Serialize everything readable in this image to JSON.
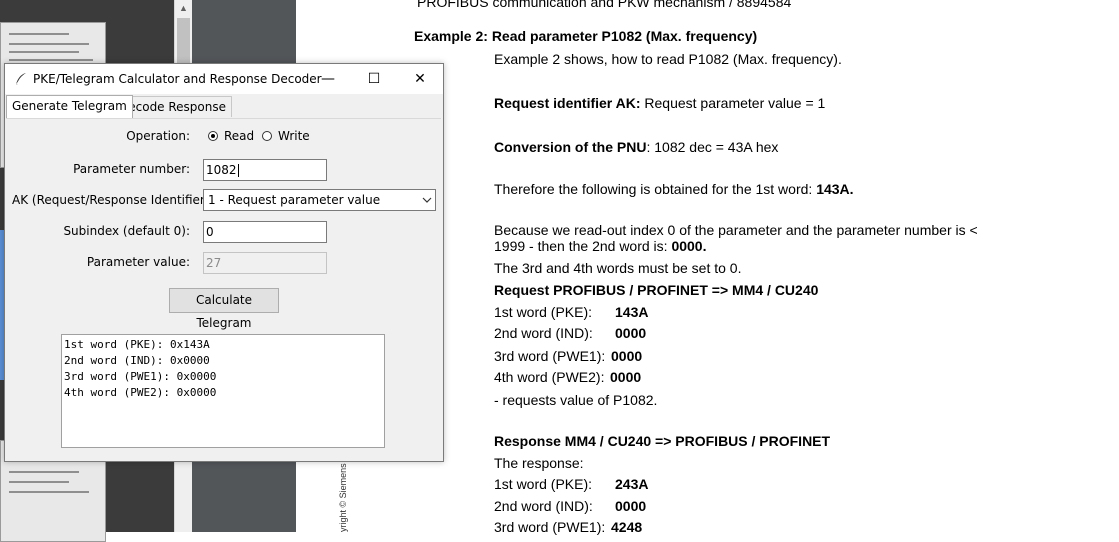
{
  "document": {
    "header_line": "PROFIBUS communication and PKW mechanism / 8894584",
    "example_title": "Example 2: Read parameter P1082 (Max. frequency)",
    "intro": "Example 2 shows, how to read P1082 (Max. frequency).",
    "req_id_label": "Request identifier AK:",
    "req_id_text": " Request parameter value = 1",
    "pnu_label": "Conversion of the PNU",
    "pnu_text": ": 1082 dec = 43A hex",
    "first_word_text": "Therefore the following is obtained for the 1st word: ",
    "first_word_value": "143A.",
    "index_line1": "Because we read-out index 0 of the parameter and the parameter number is <",
    "index_line2": "1999 - then the 2nd word is: ",
    "index_value": "0000.",
    "words_zero": "The 3rd and 4th words must be set to 0.",
    "request_heading": "Request PROFIBUS / PROFINET => MM4 / CU240",
    "request_words": [
      {
        "label": "1st word (PKE):",
        "value": "143A"
      },
      {
        "label": "2nd word (IND):",
        "value": "0000"
      },
      {
        "label": "3rd word (PWE1):",
        "value": "0000"
      },
      {
        "label": "4th word (PWE2):",
        "value": "0000"
      }
    ],
    "request_note": "- requests value of P1082.",
    "response_heading": "Response MM4 / CU240 => PROFIBUS / PROFINET",
    "response_intro": "The response:",
    "response_words": [
      {
        "label": "1st word (PKE):",
        "value": "243A"
      },
      {
        "label": "2nd word (IND):",
        "value": "0000"
      },
      {
        "label": "3rd word (PWE1):",
        "value": "4248"
      }
    ],
    "copyright": "yright © Siemens _Essentials_DP_E"
  },
  "dialog": {
    "title": "PKE/Telegram Calculator and Response Decoder",
    "minimize": "—",
    "maximize": "☐",
    "close": "✕",
    "tabs": [
      {
        "label": "Generate Telegram",
        "active": true
      },
      {
        "label": "Decode Response",
        "active": false
      }
    ],
    "operation_label": "Operation:",
    "radio_read": "Read",
    "radio_write": "Write",
    "selected_operation": "Read",
    "param_number_label": "Parameter number:",
    "param_number_value": "1082",
    "ak_label": "AK (Request/Response Identifier):",
    "ak_value": "1 - Request parameter value",
    "subindex_label": "Subindex (default 0):",
    "subindex_value": "0",
    "param_value_label": "Parameter value:",
    "param_value_value": "27",
    "calc_button": "Calculate Telegram",
    "result_lines": [
      "1st word (PKE): 0x143A",
      "2nd word (IND): 0x0000",
      "3rd word (PWE1): 0x0000",
      "4th word (PWE2): 0x0000"
    ]
  },
  "icons": {
    "title_icon": "feather-icon",
    "dropdown": "chevron-down-icon",
    "scroll_up": "arrow-up-icon"
  },
  "colors": {
    "viewer_background": "#525659",
    "dialog_background": "#f0f0f0"
  }
}
